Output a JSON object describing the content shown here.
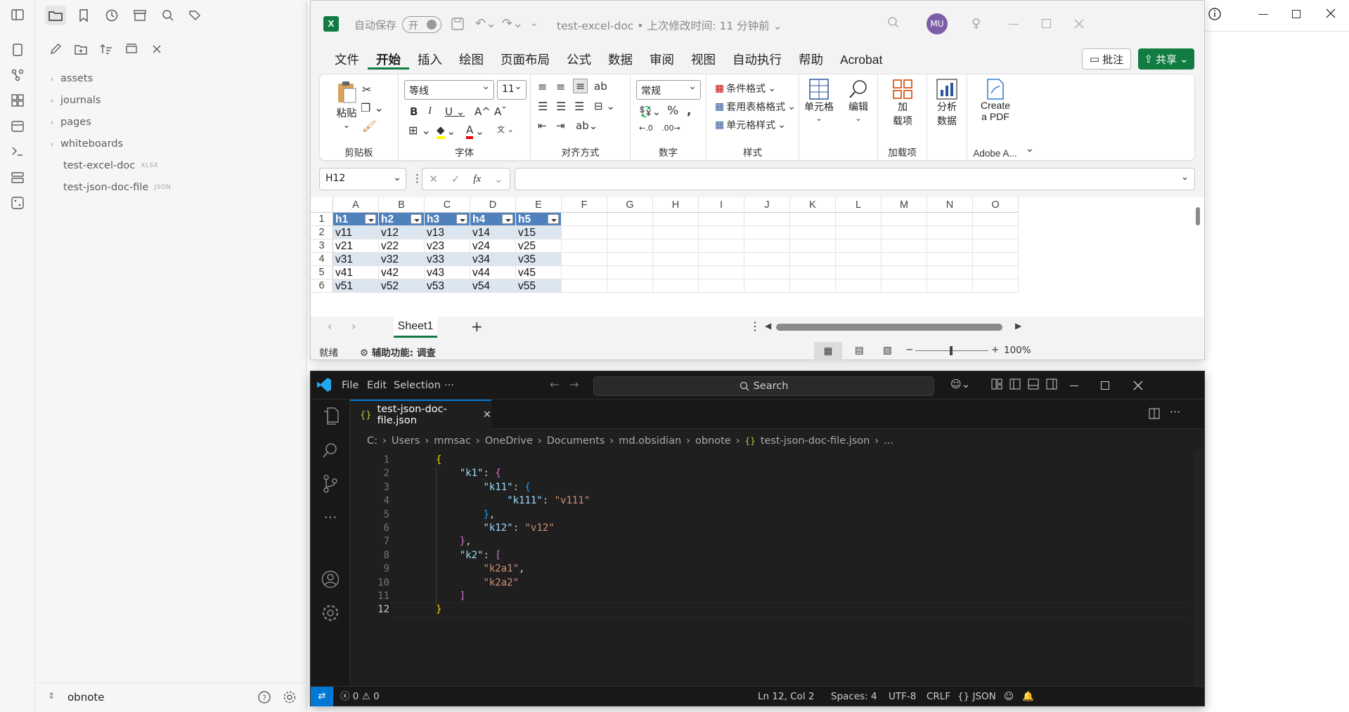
{
  "obsidian": {
    "ribbon_icons": [
      "file-search-icon",
      "graph-icon",
      "grid-icon",
      "calendar-icon",
      "terminal-icon",
      "stack-icon",
      "dice-icon"
    ],
    "top_icons": [
      "sidebar-toggle-icon",
      "folder-icon",
      "bookmark-icon",
      "clock-icon",
      "archive-icon",
      "search-icon",
      "tags-icon"
    ],
    "toolbar_icons": [
      "new-note-icon",
      "new-folder-icon",
      "sort-icon",
      "collapse-icon",
      "close-icon"
    ],
    "tree": [
      {
        "label": "assets",
        "folder": true
      },
      {
        "label": "journals",
        "folder": true
      },
      {
        "label": "pages",
        "folder": true
      },
      {
        "label": "whiteboards",
        "folder": true
      },
      {
        "label": "test-excel-doc",
        "ext": "XLSX"
      },
      {
        "label": "test-json-doc-file",
        "ext": "JSON"
      }
    ],
    "vault_name": "obnote"
  },
  "excel": {
    "autosave_label": "自动保存",
    "autosave_state": "开",
    "doc_title": "test-excel-doc",
    "last_modified": "上次修改时间: 11 分钟前",
    "user_initials": "MU",
    "tabs": [
      "文件",
      "开始",
      "插入",
      "绘图",
      "页面布局",
      "公式",
      "数据",
      "审阅",
      "视图",
      "自动执行",
      "帮助",
      "Acrobat"
    ],
    "active_tab": "开始",
    "comments_label": "批注",
    "share_label": "共享",
    "ribbon": {
      "clipboard": {
        "paste": "粘贴",
        "label": "剪贴板"
      },
      "font": {
        "name": "等线",
        "size": "11",
        "label": "字体"
      },
      "alignment": {
        "label": "对齐方式"
      },
      "number": {
        "format": "常规",
        "label": "数字"
      },
      "styles": {
        "cond": "条件格式",
        "table": "套用表格格式",
        "cell": "单元格样式",
        "label": "样式"
      },
      "cells": {
        "label": "单元格"
      },
      "editing": {
        "label": "编辑"
      },
      "addins": {
        "btn1": "加",
        "btn2": "载项",
        "label": "加载项"
      },
      "analyze": {
        "l1": "分析",
        "l2": "数据"
      },
      "acrobat": {
        "l1": "Create",
        "l2": "a PDF",
        "label": "Adobe A..."
      }
    },
    "namebox": "H12",
    "fx": "fx",
    "columns": [
      "A",
      "B",
      "C",
      "D",
      "E",
      "F",
      "G",
      "H",
      "I",
      "J",
      "K",
      "L",
      "M",
      "N",
      "O"
    ],
    "rows": [
      "1",
      "2",
      "3",
      "4",
      "5",
      "6"
    ],
    "table": [
      [
        "h1",
        "h2",
        "h3",
        "h4",
        "h5"
      ],
      [
        "v11",
        "v12",
        "v13",
        "v14",
        "v15"
      ],
      [
        "v21",
        "v22",
        "v23",
        "v24",
        "v25"
      ],
      [
        "v31",
        "v32",
        "v33",
        "v34",
        "v35"
      ],
      [
        "v41",
        "v42",
        "v43",
        "v44",
        "v45"
      ],
      [
        "v51",
        "v52",
        "v53",
        "v54",
        "v55"
      ]
    ],
    "sheet": "Sheet1",
    "status_ready": "就绪",
    "accessibility": "辅助功能: 调查",
    "zoom": "100%"
  },
  "vscode": {
    "menu": [
      "File",
      "Edit",
      "Selection",
      "···"
    ],
    "search": "Search",
    "tab": "test-json-doc-file.json",
    "breadcrumb": [
      "C:",
      "Users",
      "mmsac",
      "OneDrive",
      "Documents",
      "md.obsidian",
      "obnote",
      "test-json-doc-file.json",
      "..."
    ],
    "code": [
      "{",
      "    \"k1\": {",
      "        \"k11\": {",
      "            \"k111\": \"v111\"",
      "        },",
      "        \"k12\": \"v12\"",
      "    },",
      "    \"k2\": [",
      "        \"k2a1\",",
      "        \"k2a2\"",
      "    ]",
      "}"
    ],
    "status": {
      "errors": "0",
      "warnings": "0",
      "position": "Ln 12, Col 2",
      "spaces": "Spaces: 4",
      "encoding": "UTF-8",
      "eol": "CRLF",
      "language": "JSON"
    }
  }
}
